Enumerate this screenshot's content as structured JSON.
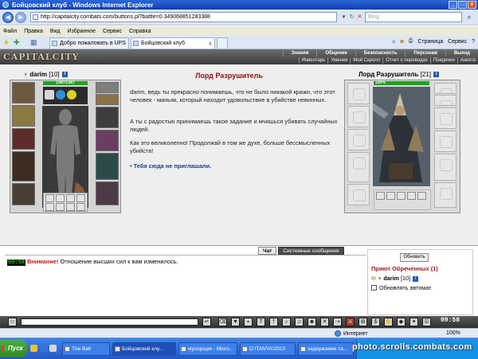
{
  "window": {
    "title": "Бойцовский клуб - Windows Internet Explorer",
    "min": "_",
    "max": "□",
    "close": "x"
  },
  "address": {
    "url": "http://capitalcity.combats.com/buttons.pl?battle=0.349068851283388",
    "search_placeholder": "Bing"
  },
  "menu": [
    "Файл",
    "Правка",
    "Вид",
    "Избранное",
    "Сервис",
    "Справка"
  ],
  "tabs": {
    "tab1": "Добро пожаловать в UPS",
    "tab2": "Бойцовский клуб",
    "tab2_close": "x"
  },
  "page_tools": {
    "page": "Страница",
    "tools": "Сервис"
  },
  "game_nav": {
    "logo": "CAPITALCITY",
    "top": [
      "Знания",
      "Общение",
      "Безопасность",
      "Персонаж",
      "Выход"
    ],
    "sub": [
      "Инвентарь",
      "Умения",
      "Мой Скролл",
      "Отчет о переводах",
      "Поединки",
      "Анкета"
    ]
  },
  "player": {
    "name": "darim",
    "level": "[10]",
    "hp": "2387/2387",
    "hp_fraction": 1.0
  },
  "npc": {
    "name": "Лорд Разрушитель",
    "level": "[21]",
    "hp": "100%",
    "hp_fraction": 1.0
  },
  "dialog": {
    "title": "Лорд Разрушитель",
    "p1": "darim, ведь ты прекрасно понимаешь, что не было никакой кражи, что этот человек - маньяк, который находит удовольствие в убийстве невинных.",
    "p2": "А ты с радостью принимаешь такое задание и мчишься убивать случайных людей.",
    "p3": "Как это великолепно! Продолжай в том же духе, больше бессмысленных убийств!",
    "link": "• Тебя сюда не приглашали."
  },
  "chat": {
    "tab_chat": "Чат",
    "tab_system": "Системные сообщения",
    "time": "09:58",
    "warning": "Внимание!",
    "message": "Отношение высших сил к вам изменилось."
  },
  "room": {
    "refresh": "Обновить",
    "name": "Приют Обреченных (1)",
    "user": "darim",
    "user_level": "[10]",
    "auto_refresh": "Обновлять автомат."
  },
  "clock": "09:58",
  "status": {
    "zone": "Интернет",
    "zoom": "100%"
  },
  "taskbar": {
    "start": "Пуск",
    "tasks": [
      "The Bat!",
      "Бойцовский клу...",
      "мусорщик - Micro...",
      "D:\\TANYA\\2010",
      "задержание та..."
    ]
  },
  "watermark": "photo.scrolls.combats.com",
  "colors": {
    "titlebar": "#2b66d9",
    "dialog_title": "#8b1010",
    "hp_green": "#1fa21f",
    "warning_red": "#c31d1d",
    "link_blue": "#1a3f86"
  }
}
